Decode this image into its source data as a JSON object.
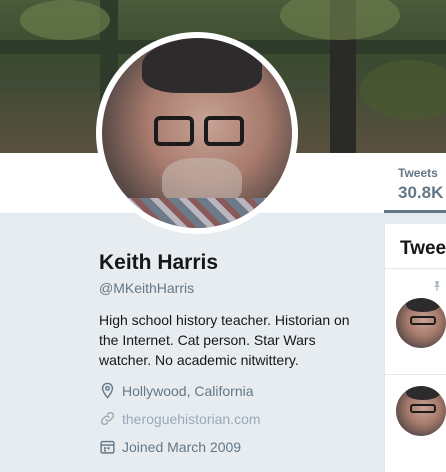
{
  "profile": {
    "name": "Keith Harris",
    "handle": "@MKeithHarris",
    "bio": "High school history teacher. Historian on the Internet. Cat person. Star Wars watcher. No academic nitwittery.",
    "location": "Hollywood, California",
    "website": "theroguehistorian.com",
    "joined": "Joined March 2009"
  },
  "nav": {
    "tweets_label": "Tweets",
    "tweets_count": "30.8K"
  },
  "timeline": {
    "title": "Tweets"
  },
  "colors": {
    "background": "#e6ecf0",
    "secondary_text": "#657786",
    "primary_text": "#14171a",
    "link_faded": "#9aa9b8"
  },
  "icons": {
    "location": "location-pin-icon",
    "link": "link-icon",
    "calendar": "calendar-icon",
    "pinned": "pin-icon"
  }
}
